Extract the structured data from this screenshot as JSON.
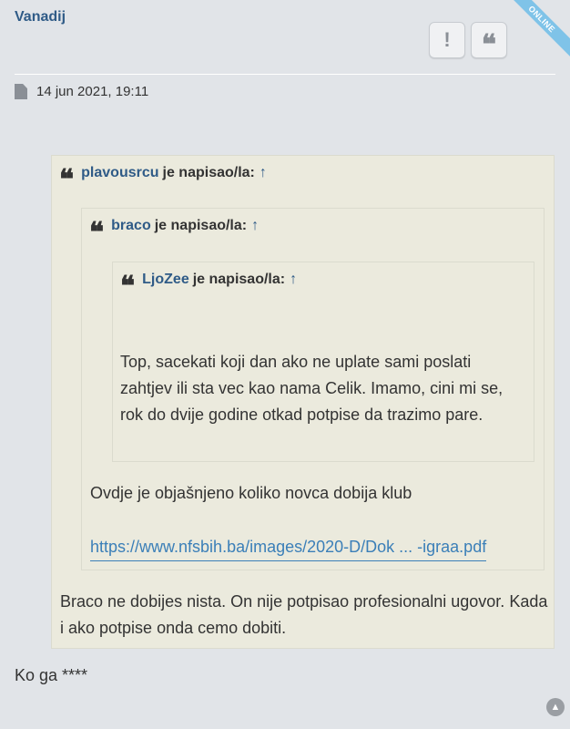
{
  "post": {
    "author": "Vanadij",
    "status_ribbon": "ONLINE",
    "report_label": "!",
    "quote_label": "❝",
    "date": "14 jun 2021, 19:11",
    "reply_text": "Ko ga ****"
  },
  "quotes": {
    "outer": {
      "user": "plavousrcu",
      "wrote": "je napisao/la:",
      "arrow": "↑",
      "text": "Braco ne dobijes nista. On nije potpisao profesionalni ugovor. Kada i ako potpise onda cemo dobiti."
    },
    "middle": {
      "user": "braco",
      "wrote": "je napisao/la:",
      "arrow": "↑",
      "text": "Ovdje je objašnjeno koliko novca dobija klub",
      "link": "https://www.nfsbih.ba/images/2020-D/Dok ... -igraa.pdf"
    },
    "inner": {
      "user": "LjoZee",
      "wrote": "je napisao/la:",
      "arrow": "↑",
      "text": "Top, sacekati koji dan ako ne uplate sami poslati zahtjev ili sta vec kao nama Celik. Imamo, cini mi se, rok do dvije godine otkad potpise da trazimo pare."
    }
  },
  "icons": {
    "quote_mark": "❝",
    "back_to_top": "▲"
  },
  "colors": {
    "background": "#e1e4e8",
    "quote_bg": "#ebeadd",
    "username": "#2f5b87",
    "link": "#3b7fb8",
    "online_ribbon": "#7fc3e8"
  }
}
